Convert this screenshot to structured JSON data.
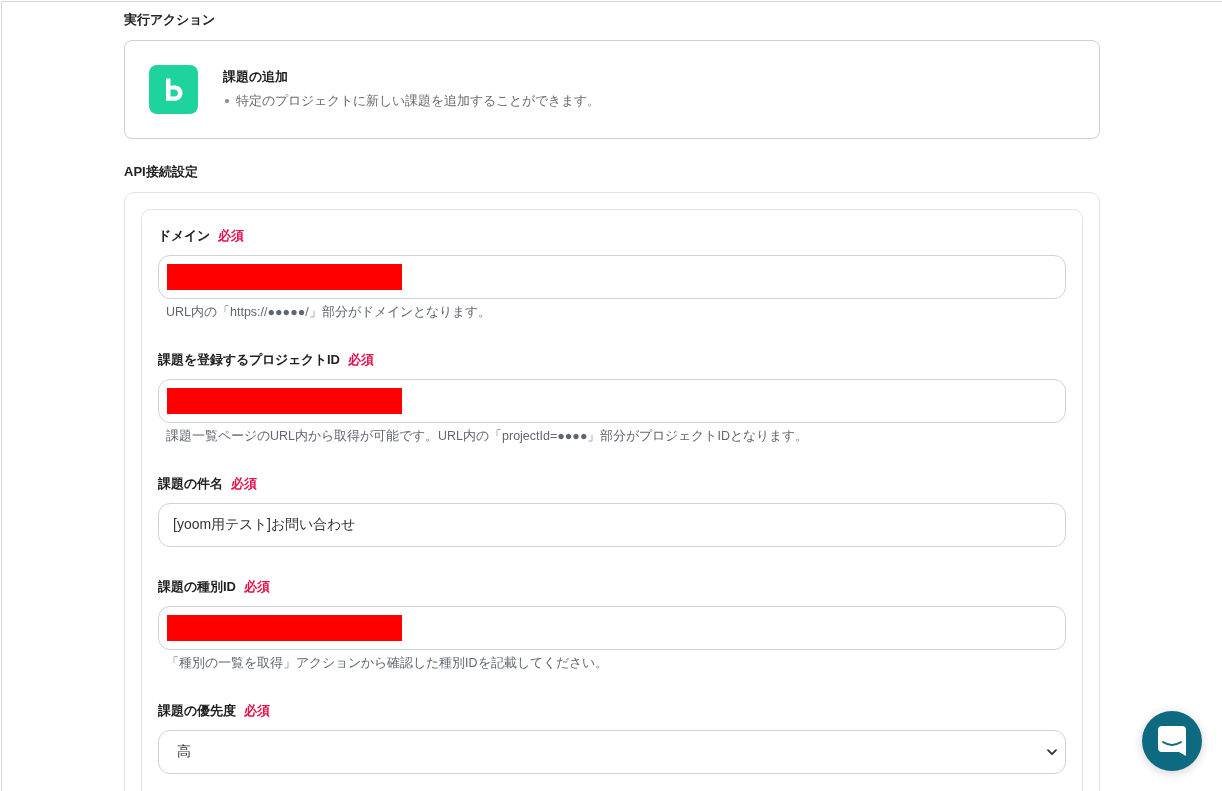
{
  "action_section": {
    "heading": "実行アクション",
    "action": {
      "title": "課題の追加",
      "bullets": [
        "特定のプロジェクトに新しい課題を追加することができます。"
      ]
    }
  },
  "api_section": {
    "heading": "API接続設定",
    "fields": [
      {
        "kind": "text",
        "label": "ドメイン",
        "required_label": "必須",
        "redacted": true,
        "help": "URL内の「https://●●●●●/」部分がドメインとなります。"
      },
      {
        "kind": "text",
        "label": "課題を登録するプロジェクトID",
        "required_label": "必須",
        "redacted": true,
        "help": "課題一覧ページのURL内から取得が可能です。URL内の「projectId=●●●●」部分がプロジェクトIDとなります。"
      },
      {
        "kind": "text",
        "label": "課題の件名",
        "required_label": "必須",
        "redacted": false,
        "value": "[yoom用テスト]お問い合わせ"
      },
      {
        "kind": "text",
        "label": "課題の種別ID",
        "required_label": "必須",
        "redacted": true,
        "help": "「種別の一覧を取得」アクションから確認した種別IDを記載してください。"
      },
      {
        "kind": "select",
        "label": "課題の優先度",
        "required_label": "必須",
        "redacted": false,
        "value": "高"
      }
    ]
  }
}
